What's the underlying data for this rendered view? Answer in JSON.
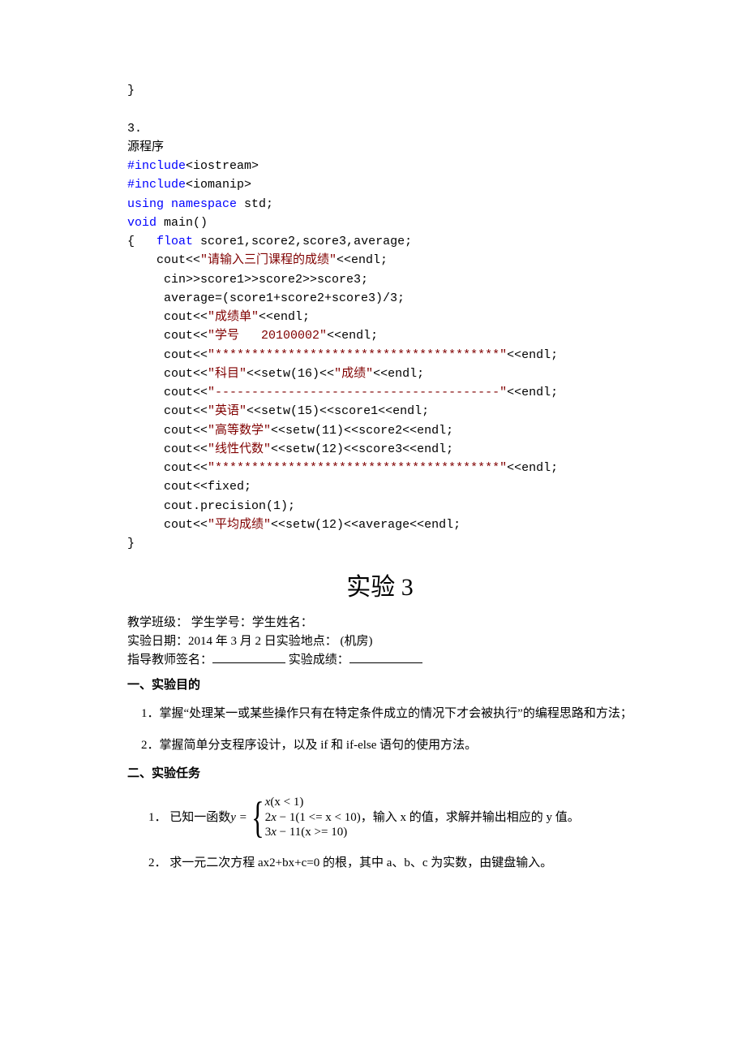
{
  "code_top": {
    "brace_close": "}",
    "sec_num": "3.",
    "sec_label": "源程序",
    "inc1_a": "#include",
    "inc1_b": "<iostream>",
    "inc2_a": "#include",
    "inc2_b": "<iomanip>",
    "using_a": "using",
    "using_b": "namespace",
    "using_c": " std;",
    "void": "void",
    "main_sig": " main()",
    "open": "{   ",
    "float": "float",
    "decls": " score1,score2,score3,average;",
    "l1a": "    cout<<",
    "l1b": "\"请输入三门课程的成绩\"",
    "l1c": "<<endl;",
    "l2": "     cin>>score1>>score2>>score3;",
    "l3": "     average=(score1+score2+score3)/3;",
    "l4a": "     cout<<",
    "l4b": "\"成绩单\"",
    "l4c": "<<endl;",
    "l5a": "     cout<<",
    "l5b": "\"学号   20100002\"",
    "l5c": "<<endl;",
    "l6a": "     cout<<",
    "l6b": "\"***************************************\"",
    "l6c": "<<endl;",
    "l7a": "     cout<<",
    "l7b": "\"科目\"",
    "l7c": "<<setw(16)<<",
    "l7d": "\"成绩\"",
    "l7e": "<<endl;",
    "l8a": "     cout<<",
    "l8b": "\"---------------------------------------\"",
    "l8c": "<<endl;",
    "l9a": "     cout<<",
    "l9b": "\"英语\"",
    "l9c": "<<setw(15)<<score1<<endl;",
    "l10a": "     cout<<",
    "l10b": "\"高等数学\"",
    "l10c": "<<setw(11)<<score2<<endl;",
    "l11a": "     cout<<",
    "l11b": "\"线性代数\"",
    "l11c": "<<setw(12)<<score3<<endl;",
    "l12a": "     cout<<",
    "l12b": "\"***************************************\"",
    "l12c": "<<endl;",
    "l13": "     cout<<fixed;",
    "l14": "     cout.precision(1);",
    "l15a": "     cout<<",
    "l15b": "\"平均成绩\"",
    "l15c": "<<setw(12)<<average<<endl;",
    "close": "}"
  },
  "title": "实验 3",
  "meta": {
    "line1": "教学班级：  学生学号：学生姓名：",
    "line2": "实验日期：2014 年 3 月 2 日实验地点：  (机房)",
    "line3a": "指导教师签名：",
    "line3b": "  实验成绩："
  },
  "sec1_head": "一、实验目的",
  "sec1_items": [
    "1．掌握“处理某一或某些操作只有在特定条件成立的情况下才会被执行”的编程思路和方法；",
    "2．掌握简单分支程序设计，以及 if 和 if-else 语句的使用方法。"
  ],
  "sec2_head": "二、实验任务",
  "task1": {
    "prefix": "1． 已知一函数 ",
    "yeq": "y = ",
    "cases": [
      {
        "expr_var": "x",
        "cond": "(x < 1)"
      },
      {
        "expr": "2",
        "expr_var": "x",
        "minus": " − 1",
        "cond": "(1 <= x < 10)"
      },
      {
        "expr": "3",
        "expr_var": "x",
        "minus": " − 11",
        "cond": "(x >= 10)"
      }
    ],
    "suffix": " ，输入 x 的值，求解并输出相应的 y 值。"
  },
  "task2": "2． 求一元二次方程 ax2+bx+c=0 的根，其中 a、b、c 为实数，由键盘输入。"
}
